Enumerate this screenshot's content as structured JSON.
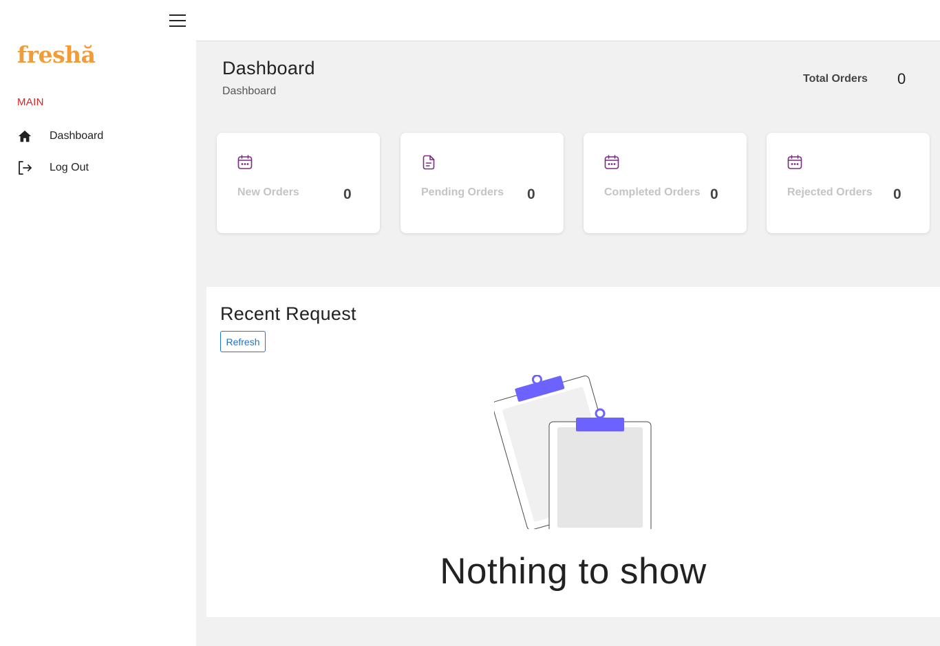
{
  "brand": {
    "logo_text": "freshă",
    "color": "#f29c38"
  },
  "sidebar": {
    "section_label": "MAIN",
    "items": [
      {
        "label": "Dashboard",
        "icon": "home-icon"
      },
      {
        "label": "Log Out",
        "icon": "logout-icon"
      }
    ]
  },
  "header": {
    "title": "Dashboard",
    "breadcrumb": "Dashboard",
    "total_orders_label": "Total Orders",
    "total_orders_value": "0"
  },
  "stats": [
    {
      "label": "New Orders",
      "value": "0",
      "icon": "calendar-icon"
    },
    {
      "label": "Pending Orders",
      "value": "0",
      "icon": "document-icon"
    },
    {
      "label": "Completed Orders",
      "value": "0",
      "icon": "calendar-icon"
    },
    {
      "label": "Rejected Orders",
      "value": "0",
      "icon": "calendar-icon"
    }
  ],
  "recent": {
    "title": "Recent Request",
    "refresh_label": "Refresh",
    "empty_text": "Nothing to show"
  },
  "colors": {
    "accent_purple": "#7b2c82",
    "illustration_clip": "#6c63ff",
    "link_blue": "#1976d2",
    "section_red": "#e0201b"
  }
}
